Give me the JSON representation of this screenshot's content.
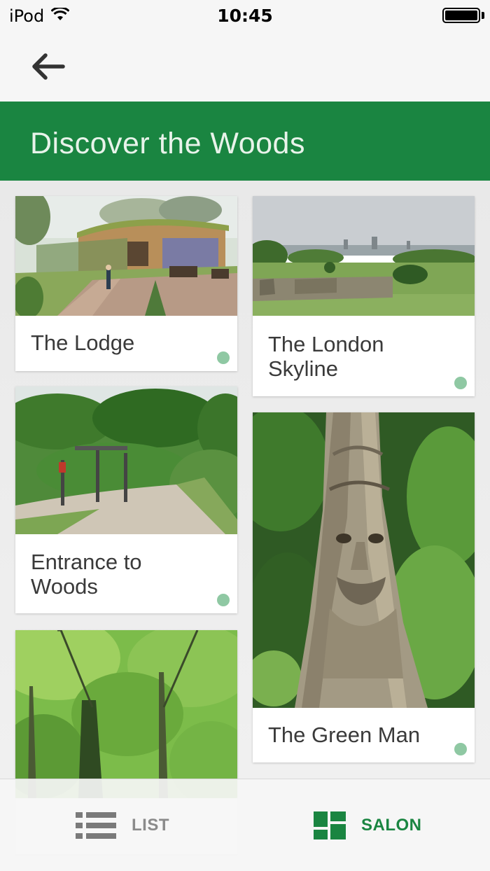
{
  "status_bar": {
    "carrier": "iPod",
    "time": "10:45",
    "battery_level": 1.0
  },
  "nav": {
    "back_icon": "arrow-left-icon"
  },
  "header": {
    "title": "Discover the Woods",
    "background_color": "#1a8541"
  },
  "cards": [
    {
      "title": "The Lodge",
      "image": "lodge-rendering",
      "dot_color": "#8fc8a3"
    },
    {
      "title": "The London Skyline",
      "image": "london-skyline-park",
      "dot_color": "#8fc8a3"
    },
    {
      "title": "Entrance to Woods",
      "image": "woods-entrance-path",
      "dot_color": "#8fc8a3"
    },
    {
      "title": "The Green Man",
      "image": "carved-tree-face",
      "dot_color": "#8fc8a3"
    },
    {
      "title": "",
      "image": "tree-canopy"
    }
  ],
  "tab_bar": {
    "tabs": [
      {
        "label": "LIST",
        "icon": "list-icon",
        "active": false
      },
      {
        "label": "SALON",
        "icon": "grid-icon",
        "active": true
      }
    ],
    "active_color": "#1a8541",
    "inactive_color": "#8a8a8a"
  }
}
